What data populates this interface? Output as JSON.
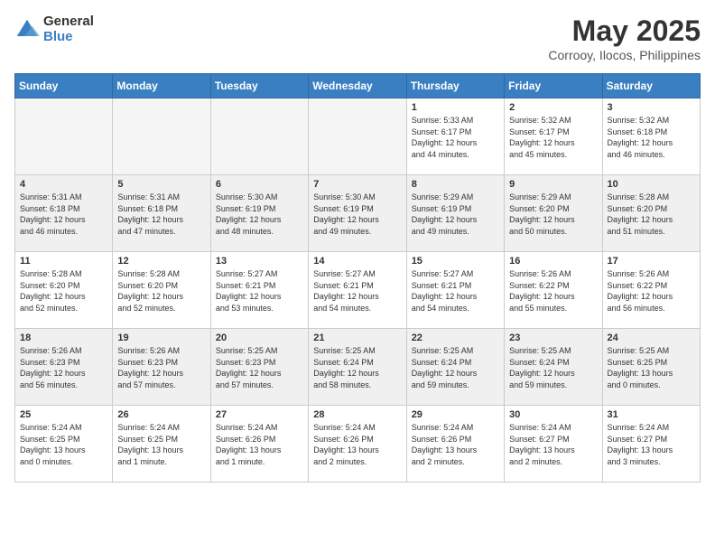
{
  "logo": {
    "general": "General",
    "blue": "Blue"
  },
  "title": "May 2025",
  "location": "Corrooy, Ilocos, Philippines",
  "days_header": [
    "Sunday",
    "Monday",
    "Tuesday",
    "Wednesday",
    "Thursday",
    "Friday",
    "Saturday"
  ],
  "weeks": [
    [
      {
        "day": "",
        "info": ""
      },
      {
        "day": "",
        "info": ""
      },
      {
        "day": "",
        "info": ""
      },
      {
        "day": "",
        "info": ""
      },
      {
        "day": "1",
        "info": "Sunrise: 5:33 AM\nSunset: 6:17 PM\nDaylight: 12 hours\nand 44 minutes."
      },
      {
        "day": "2",
        "info": "Sunrise: 5:32 AM\nSunset: 6:17 PM\nDaylight: 12 hours\nand 45 minutes."
      },
      {
        "day": "3",
        "info": "Sunrise: 5:32 AM\nSunset: 6:18 PM\nDaylight: 12 hours\nand 46 minutes."
      }
    ],
    [
      {
        "day": "4",
        "info": "Sunrise: 5:31 AM\nSunset: 6:18 PM\nDaylight: 12 hours\nand 46 minutes."
      },
      {
        "day": "5",
        "info": "Sunrise: 5:31 AM\nSunset: 6:18 PM\nDaylight: 12 hours\nand 47 minutes."
      },
      {
        "day": "6",
        "info": "Sunrise: 5:30 AM\nSunset: 6:19 PM\nDaylight: 12 hours\nand 48 minutes."
      },
      {
        "day": "7",
        "info": "Sunrise: 5:30 AM\nSunset: 6:19 PM\nDaylight: 12 hours\nand 49 minutes."
      },
      {
        "day": "8",
        "info": "Sunrise: 5:29 AM\nSunset: 6:19 PM\nDaylight: 12 hours\nand 49 minutes."
      },
      {
        "day": "9",
        "info": "Sunrise: 5:29 AM\nSunset: 6:20 PM\nDaylight: 12 hours\nand 50 minutes."
      },
      {
        "day": "10",
        "info": "Sunrise: 5:28 AM\nSunset: 6:20 PM\nDaylight: 12 hours\nand 51 minutes."
      }
    ],
    [
      {
        "day": "11",
        "info": "Sunrise: 5:28 AM\nSunset: 6:20 PM\nDaylight: 12 hours\nand 52 minutes."
      },
      {
        "day": "12",
        "info": "Sunrise: 5:28 AM\nSunset: 6:20 PM\nDaylight: 12 hours\nand 52 minutes."
      },
      {
        "day": "13",
        "info": "Sunrise: 5:27 AM\nSunset: 6:21 PM\nDaylight: 12 hours\nand 53 minutes."
      },
      {
        "day": "14",
        "info": "Sunrise: 5:27 AM\nSunset: 6:21 PM\nDaylight: 12 hours\nand 54 minutes."
      },
      {
        "day": "15",
        "info": "Sunrise: 5:27 AM\nSunset: 6:21 PM\nDaylight: 12 hours\nand 54 minutes."
      },
      {
        "day": "16",
        "info": "Sunrise: 5:26 AM\nSunset: 6:22 PM\nDaylight: 12 hours\nand 55 minutes."
      },
      {
        "day": "17",
        "info": "Sunrise: 5:26 AM\nSunset: 6:22 PM\nDaylight: 12 hours\nand 56 minutes."
      }
    ],
    [
      {
        "day": "18",
        "info": "Sunrise: 5:26 AM\nSunset: 6:23 PM\nDaylight: 12 hours\nand 56 minutes."
      },
      {
        "day": "19",
        "info": "Sunrise: 5:26 AM\nSunset: 6:23 PM\nDaylight: 12 hours\nand 57 minutes."
      },
      {
        "day": "20",
        "info": "Sunrise: 5:25 AM\nSunset: 6:23 PM\nDaylight: 12 hours\nand 57 minutes."
      },
      {
        "day": "21",
        "info": "Sunrise: 5:25 AM\nSunset: 6:24 PM\nDaylight: 12 hours\nand 58 minutes."
      },
      {
        "day": "22",
        "info": "Sunrise: 5:25 AM\nSunset: 6:24 PM\nDaylight: 12 hours\nand 59 minutes."
      },
      {
        "day": "23",
        "info": "Sunrise: 5:25 AM\nSunset: 6:24 PM\nDaylight: 12 hours\nand 59 minutes."
      },
      {
        "day": "24",
        "info": "Sunrise: 5:25 AM\nSunset: 6:25 PM\nDaylight: 13 hours\nand 0 minutes."
      }
    ],
    [
      {
        "day": "25",
        "info": "Sunrise: 5:24 AM\nSunset: 6:25 PM\nDaylight: 13 hours\nand 0 minutes."
      },
      {
        "day": "26",
        "info": "Sunrise: 5:24 AM\nSunset: 6:25 PM\nDaylight: 13 hours\nand 1 minute."
      },
      {
        "day": "27",
        "info": "Sunrise: 5:24 AM\nSunset: 6:26 PM\nDaylight: 13 hours\nand 1 minute."
      },
      {
        "day": "28",
        "info": "Sunrise: 5:24 AM\nSunset: 6:26 PM\nDaylight: 13 hours\nand 2 minutes."
      },
      {
        "day": "29",
        "info": "Sunrise: 5:24 AM\nSunset: 6:26 PM\nDaylight: 13 hours\nand 2 minutes."
      },
      {
        "day": "30",
        "info": "Sunrise: 5:24 AM\nSunset: 6:27 PM\nDaylight: 13 hours\nand 2 minutes."
      },
      {
        "day": "31",
        "info": "Sunrise: 5:24 AM\nSunset: 6:27 PM\nDaylight: 13 hours\nand 3 minutes."
      }
    ]
  ],
  "row_shading": [
    false,
    true,
    false,
    true,
    false
  ]
}
